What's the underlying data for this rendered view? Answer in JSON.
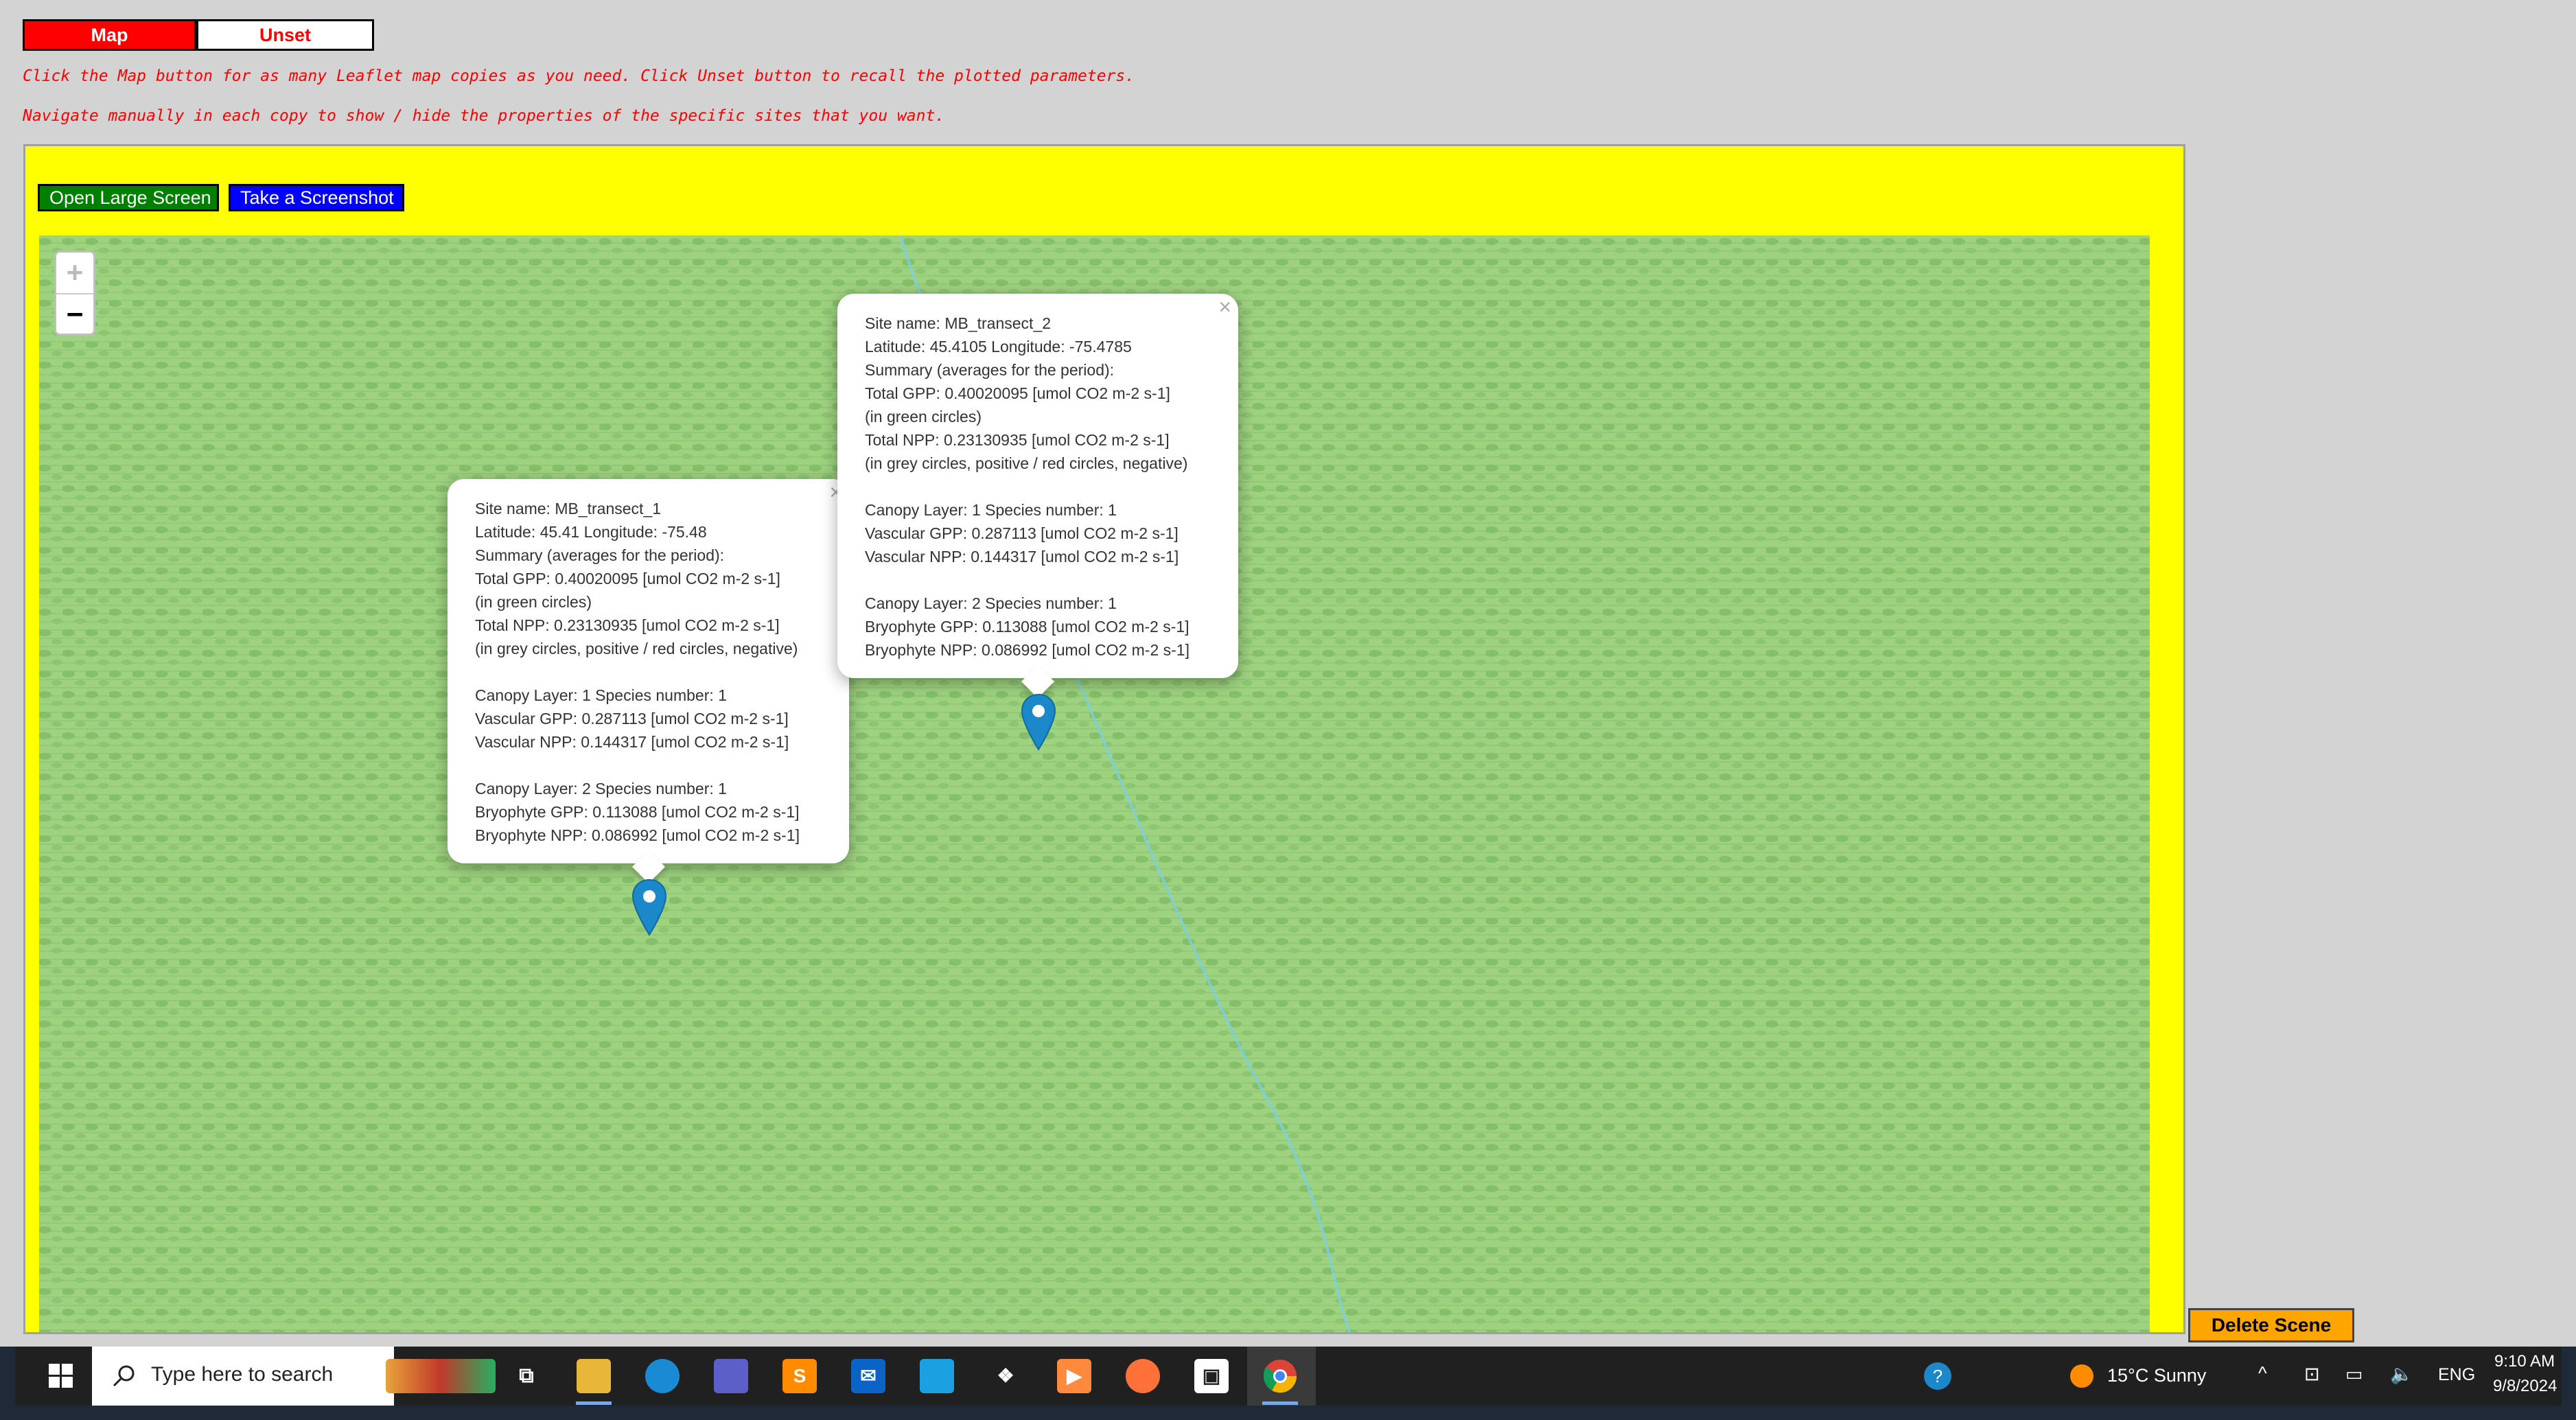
{
  "controls": {
    "map_label": "Map",
    "unset_label": "Unset",
    "instruction_1": "Click the Map button for as many Leaflet map copies as you need. Click Unset button to recall the plotted parameters.",
    "instruction_2": "Navigate manually in each copy to show / hide the properties of the specific sites that you want."
  },
  "frame": {
    "open_large_label": "Open Large Screen",
    "screenshot_label": "Take a Screenshot",
    "zoom_in": "+",
    "zoom_out": "−",
    "delete_scene_label": "Delete Scene"
  },
  "popups": [
    {
      "close": "×",
      "site": "Site name: MB_transect_1",
      "coords": "Latitude: 45.41 Longitude: -75.48",
      "summary": "Summary (averages for the period):",
      "total_gpp": "Total GPP: 0.40020095 [umol CO2 m-2 s-1]",
      "gpp_note": "(in green circles)",
      "total_npp": "Total NPP: 0.23130935 [umol CO2 m-2 s-1]",
      "npp_note": "(in grey circles, positive / red circles, negative)",
      "canopy1": "Canopy Layer: 1 Species number: 1",
      "vascular_gpp": "Vascular GPP: 0.287113 [umol CO2 m-2 s-1]",
      "vascular_npp": "Vascular NPP: 0.144317 [umol CO2 m-2 s-1]",
      "canopy2": "Canopy Layer: 2 Species number: 1",
      "bryophyte_gpp": "Bryophyte GPP: 0.113088 [umol CO2 m-2 s-1]",
      "bryophyte_npp": "Bryophyte NPP: 0.086992 [umol CO2 m-2 s-1]"
    },
    {
      "close": "×",
      "site": "Site name: MB_transect_2",
      "coords": "Latitude: 45.4105 Longitude: -75.4785",
      "summary": "Summary (averages for the period):",
      "total_gpp": "Total GPP: 0.40020095 [umol CO2 m-2 s-1]",
      "gpp_note": "(in green circles)",
      "total_npp": "Total NPP: 0.23130935 [umol CO2 m-2 s-1]",
      "npp_note": "(in grey circles, positive / red circles, negative)",
      "canopy1": "Canopy Layer: 1 Species number: 1",
      "vascular_gpp": "Vascular GPP: 0.287113 [umol CO2 m-2 s-1]",
      "vascular_npp": "Vascular NPP: 0.144317 [umol CO2 m-2 s-1]",
      "canopy2": "Canopy Layer: 2 Species number: 1",
      "bryophyte_gpp": "Bryophyte GPP: 0.113088 [umol CO2 m-2 s-1]",
      "bryophyte_npp": "Bryophyte NPP: 0.086992 [umol CO2 m-2 s-1]"
    }
  ],
  "taskbar": {
    "search_placeholder": "Type here to search",
    "weather": "15°C  Sunny",
    "language": "ENG",
    "time": "9:10 AM",
    "date": "9/8/2024",
    "pinned_icons": [
      "task-view-icon",
      "file-explorer-icon",
      "edge-icon",
      "store-icon",
      "sublime-icon",
      "mail-icon",
      "app-icon",
      "dropbox-icon",
      "media-icon",
      "firefox-icon",
      "notes-icon",
      "chrome-icon"
    ]
  },
  "colors": {
    "map_button": "#ff0000",
    "instruction_text": "#ff0000",
    "frame_background": "#ffff00",
    "open_large_button": "#008000",
    "screenshot_button": "#0000ff",
    "delete_scene_button": "#ffa500",
    "map_background": "#9fd27f",
    "marker": "#1a88c9"
  }
}
